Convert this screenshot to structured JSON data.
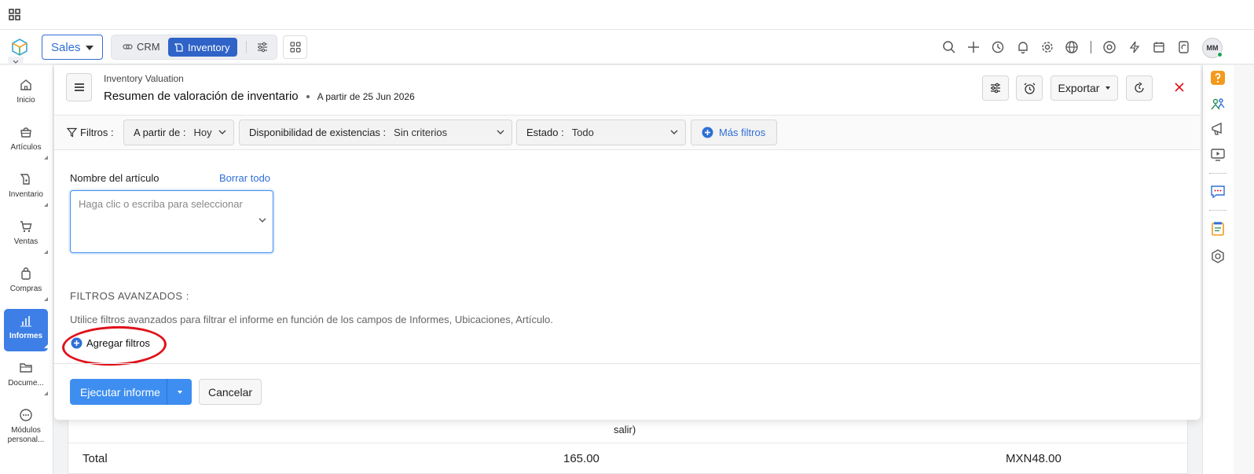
{
  "header": {
    "module_select": "Sales",
    "apps": {
      "crm": "CRM",
      "inventory": "Inventory"
    },
    "avatar_initials": "MM",
    "accent": "#2f63c7"
  },
  "sidebar": {
    "items": [
      {
        "label": "Inicio",
        "icon": "home-icon"
      },
      {
        "label": "Artículos",
        "icon": "basket-icon"
      },
      {
        "label": "Inventario",
        "icon": "inventory-icon"
      },
      {
        "label": "Ventas",
        "icon": "cart-icon"
      },
      {
        "label": "Compras",
        "icon": "bag-icon"
      },
      {
        "label": "Informes",
        "icon": "chart-icon",
        "active": true
      },
      {
        "label": "Docume...",
        "icon": "folder-icon"
      },
      {
        "label": "Módulos personal...",
        "icon": "more-icon"
      }
    ]
  },
  "report": {
    "subtitle": "Inventory Valuation",
    "title": "Resumen de valoración de inventario",
    "as_of": "A partir de 25 Jun 2026",
    "export_label": "Exportar"
  },
  "filters": {
    "label": "Filtros :",
    "as_of": {
      "label": "A partir de :",
      "value": "Hoy"
    },
    "stock": {
      "label": "Disponibilidad de existencias :",
      "value": "Sin criterios"
    },
    "status": {
      "label": "Estado :",
      "value": "Todo"
    },
    "more": "Más filtros"
  },
  "form": {
    "item_label": "Nombre del artículo",
    "clear_all": "Borrar todo",
    "item_placeholder": "Haga clic o escriba para seleccionar",
    "advanced_title": "FILTROS AVANZADOS :",
    "advanced_desc": "Utilice filtros avanzados para filtrar el informe en función de los campos de Informes, Ubicaciones, Artículo.",
    "add_filters": "Agregar filtros",
    "run": "Ejecutar informe",
    "cancel": "Cancelar"
  },
  "background_report": {
    "wrapped_text": "salir)",
    "total_label": "Total",
    "total_qty": "165.00",
    "total_amount": "MXN48.00"
  }
}
